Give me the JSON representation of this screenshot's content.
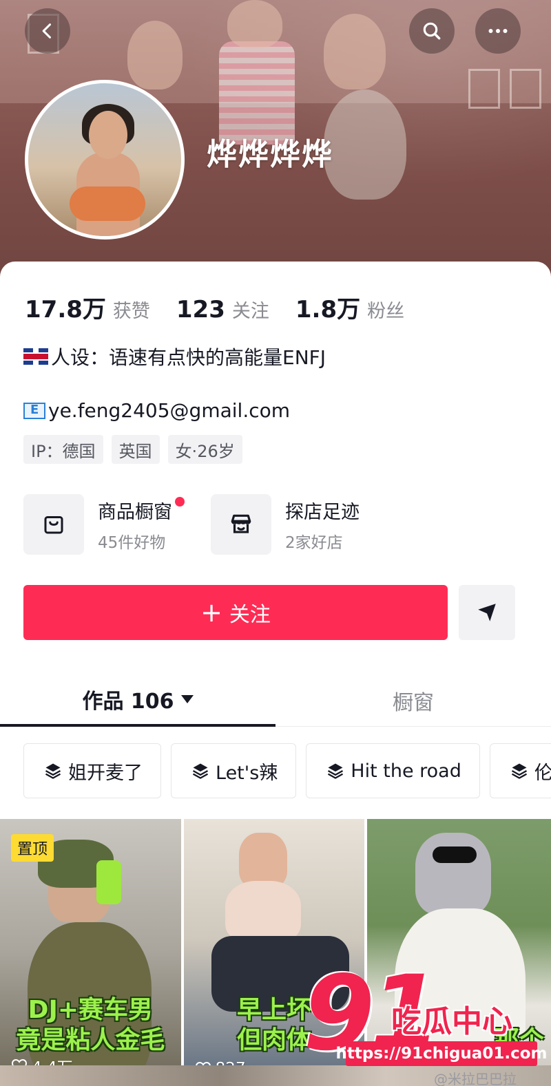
{
  "header": {
    "back_icon": "chevron-left-icon",
    "search_icon": "search-icon",
    "more_icon": "more-horizontal-icon",
    "nickname": "烨烨烨烨"
  },
  "stats": [
    {
      "value": "17.8万",
      "label": "获赞"
    },
    {
      "value": "123",
      "label": "关注"
    },
    {
      "value": "1.8万",
      "label": "粉丝"
    }
  ],
  "bio": {
    "flag_icon": "uk-flag-icon",
    "text": "人设：语速有点快的高能量ENFJ",
    "email_icon": "email-icon",
    "email": "ye.feng2405@gmail.com"
  },
  "tags": [
    "IP：德国",
    "英国",
    "女·26岁"
  ],
  "shops": [
    {
      "title": "商品橱窗",
      "sub": "45件好物",
      "icon": "shopping-bag-icon",
      "has_dot": true
    },
    {
      "title": "探店足迹",
      "sub": "2家好店",
      "icon": "store-icon",
      "has_dot": false
    }
  ],
  "actions": {
    "follow_label": "关注",
    "follow_icon": "plus-icon",
    "share_icon": "send-icon"
  },
  "tabs": [
    {
      "label": "作品 106",
      "active": true
    },
    {
      "label": "橱窗",
      "active": false
    }
  ],
  "collections": [
    "姐开麦了",
    "Let's辣",
    "Hit the road",
    "伦"
  ],
  "videos": [
    {
      "pinned_label": "置顶",
      "caption_line1": "DJ+赛车男",
      "caption_line2": "竟是粘人金毛",
      "likes": "4.4万"
    },
    {
      "pinned_label": "",
      "caption_line1": "早上坏",
      "caption_line2": "但肉体",
      "likes": "827"
    },
    {
      "pinned_label": "",
      "caption_line1": "那个",
      "caption_line2": "",
      "likes": ""
    }
  ],
  "watermark": {
    "logo_number": "91",
    "logo_text": "吃瓜中心",
    "url": "https://91chigua01.com",
    "weibo": "@米拉巴巴拉"
  },
  "colors": {
    "accent": "#fe2c55",
    "pin_badge": "#fddb32",
    "caption_green": "#9cf14c"
  }
}
